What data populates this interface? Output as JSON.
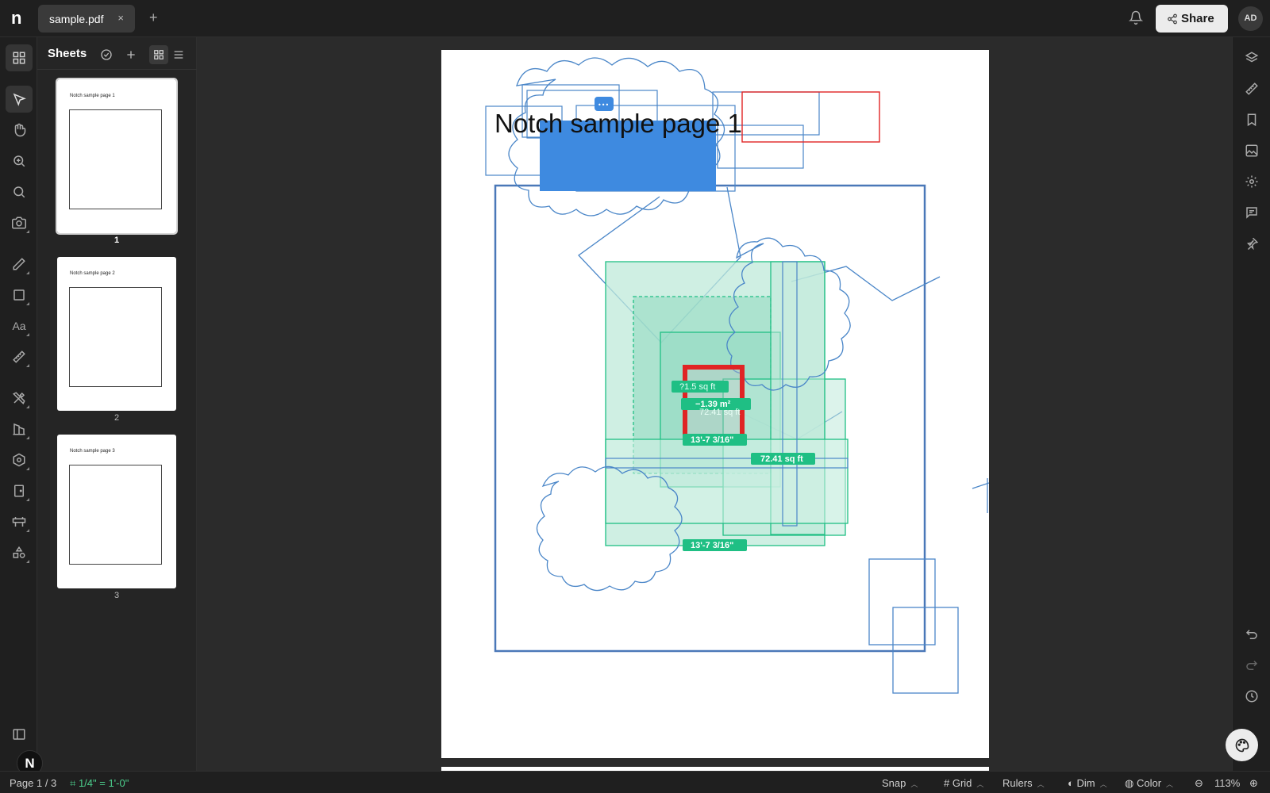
{
  "app": {
    "logo": "n"
  },
  "tabs": [
    {
      "label": "sample.pdf",
      "close": "×"
    }
  ],
  "new_tab": "+",
  "header": {
    "share_label": "Share",
    "avatar_initials": "AD"
  },
  "sheets": {
    "title": "Sheets",
    "pages": [
      {
        "title": "Notch sample page 1",
        "number": "1",
        "selected": true
      },
      {
        "title": "Notch sample page 2",
        "number": "2",
        "selected": false
      },
      {
        "title": "Notch sample page 3",
        "number": "3",
        "selected": false
      }
    ]
  },
  "canvas": {
    "page_heading": "Notch sample page 1",
    "more_menu": "•••",
    "measurements": {
      "area_1": "?1.5 sq ft",
      "area_neg": "−1.39 m²",
      "area_2": "72.41 sq ft",
      "area_3": "72.41 sq ft",
      "length_1": "13'-7 3/16\"",
      "length_2": "13'-7 3/16\""
    }
  },
  "left_tools": [
    "sheets-icon",
    "select-icon",
    "hand-icon",
    "zoom-in-icon",
    "search-icon",
    "camera-icon",
    "pen-icon",
    "rectangle-icon",
    "text-icon",
    "measure-icon",
    "tools-icon",
    "building-icon",
    "settings-polygon-icon",
    "door-icon",
    "barrier-icon",
    "shapes-icon",
    "sidebar-toggle-icon"
  ],
  "right_tools": [
    "layers-icon",
    "ruler-icon",
    "bookmark-icon",
    "image-icon",
    "gear-icon",
    "comment-icon",
    "pin-icon",
    "undo-icon",
    "redo-icon",
    "history-icon"
  ],
  "status": {
    "page": "Page 1 / 3",
    "scale": "1/4\" = 1'-0\"",
    "snap": "Snap",
    "grid": "Grid",
    "rulers": "Rulers",
    "dim": "Dim",
    "color": "Color",
    "zoom": "113%"
  },
  "colors": {
    "accent_green": "#1fbf84",
    "measure_red": "#e02424",
    "line_blue": "#4a86c8",
    "fill_blue": "#3e8ae0"
  }
}
